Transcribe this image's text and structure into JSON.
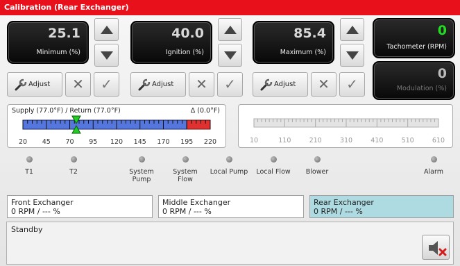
{
  "title": "Calibration (Rear Exchanger)",
  "readouts": {
    "minimum": {
      "value": "25.1",
      "label": "Minimum (%)"
    },
    "ignition": {
      "value": "40.0",
      "label": "Ignition (%)"
    },
    "maximum": {
      "value": "85.4",
      "label": "Maximum (%)"
    },
    "tachometer": {
      "value": "0",
      "label": "Tachometer (RPM)"
    },
    "modulation": {
      "value": "0",
      "label": "Modulation (%)"
    }
  },
  "adjust_label": "Adjust",
  "temp_gauge": {
    "supply_return": "Supply (77.0°F) / Return (77.0°F)",
    "delta": "Δ (0.0°F)",
    "ticks": [
      "20",
      "45",
      "70",
      "95",
      "120",
      "145",
      "170",
      "195",
      "220"
    ],
    "range": [
      20,
      220
    ],
    "marker_value": 77.0,
    "red_zone_start": 195
  },
  "rpm_gauge": {
    "ticks": [
      "10",
      "110",
      "210",
      "310",
      "410",
      "510",
      "610"
    ]
  },
  "indicators": [
    {
      "label": "T1"
    },
    {
      "label": "T2"
    },
    {
      "label": "System Pump"
    },
    {
      "label": "System Flow"
    },
    {
      "label": "Local Pump"
    },
    {
      "label": "Local Flow"
    },
    {
      "label": "Blower"
    },
    {
      "label": "Alarm"
    }
  ],
  "exchangers": [
    {
      "name": "Front Exchanger",
      "status": "0 RPM / --- %"
    },
    {
      "name": "Middle Exchanger",
      "status": "0 RPM / --- %"
    },
    {
      "name": "Rear Exchanger",
      "status": "0 RPM / --- %"
    }
  ],
  "status_text": "Standby",
  "colors": {
    "title_bar": "#e8101a",
    "active_exchanger": "#aedbe1",
    "tach_value": "#22dd22"
  },
  "icons": {
    "adjust": "wrench-icon",
    "cancel": "x-icon",
    "confirm": "check-icon",
    "mute": "speaker-mute-icon"
  }
}
